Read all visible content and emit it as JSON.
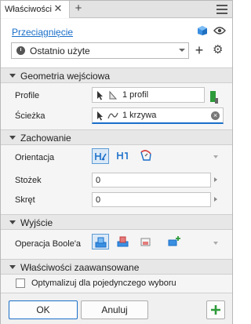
{
  "tab": {
    "label": "Właściwości",
    "close": "✕",
    "add": "+"
  },
  "header": {
    "link": "Przeciągnięcie",
    "preset": {
      "value": "Ostatnio użyte"
    },
    "add": "+",
    "settings_icon": "⚙"
  },
  "sections": {
    "geometry": {
      "title": "Geometria wejściowa",
      "profile_label": "Profile",
      "profile_value": "1 profil",
      "path_label": "Ścieżka",
      "path_value": "1 krzywa",
      "clear": "×"
    },
    "behavior": {
      "title": "Zachowanie",
      "orientation_label": "Orientacja",
      "taper_label": "Stożek",
      "taper_value": "0",
      "twist_label": "Skręt",
      "twist_value": "0"
    },
    "output": {
      "title": "Wyjście",
      "boolean_label": "Operacja Boole'a"
    },
    "advanced": {
      "title": "Właściwości zaawansowane",
      "optimize_label": "Optymalizuj dla pojedynczego wyboru",
      "optimize_checked": false
    }
  },
  "footer": {
    "ok": "OK",
    "cancel": "Anuluj"
  },
  "colors": {
    "accent": "#1a6fc9",
    "green": "#2e9b3a"
  }
}
